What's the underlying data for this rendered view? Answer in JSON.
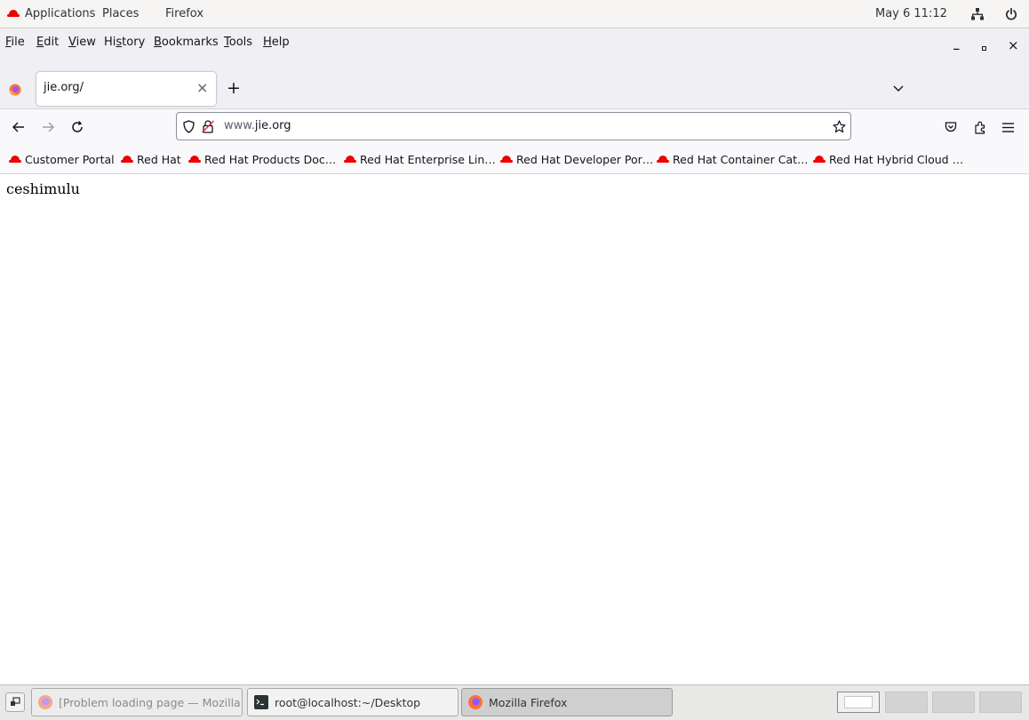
{
  "topbar": {
    "applications": "Applications",
    "places": "Places",
    "firefox": "Firefox",
    "clock": "May 6  11:12"
  },
  "menubar": {
    "file": "ile",
    "edit": "dit",
    "view": "iew",
    "history_a": "Hi",
    "history_b": "tory",
    "bookmarks_a": "",
    "bookmarks_b": "ookmarks",
    "tools": "ools",
    "help": "elp"
  },
  "window_controls": {
    "minimize": "_",
    "maximize": "▫",
    "close": "×"
  },
  "tab": {
    "title": "jie.org/",
    "close": "×",
    "new_tab": "+"
  },
  "urlbar": {
    "prefix": "www.",
    "domain": "jie.org"
  },
  "bookmarks": [
    "Customer Portal",
    "Red Hat",
    "Red Hat Products Doc…",
    "Red Hat Enterprise Lin…",
    "Red Hat Developer Por…",
    "Red Hat Container Cat…",
    "Red Hat Hybrid Cloud …"
  ],
  "content": {
    "text": "ceshimulu"
  },
  "taskbar": {
    "tasks": [
      "[Problem loading page — Mozilla …",
      "root@localhost:~/Desktop",
      "Mozilla Firefox"
    ]
  },
  "colors": {
    "accent_red": "#ee0000",
    "firefox_orange": "#ff7139",
    "firefox_purple": "#9059ff"
  }
}
